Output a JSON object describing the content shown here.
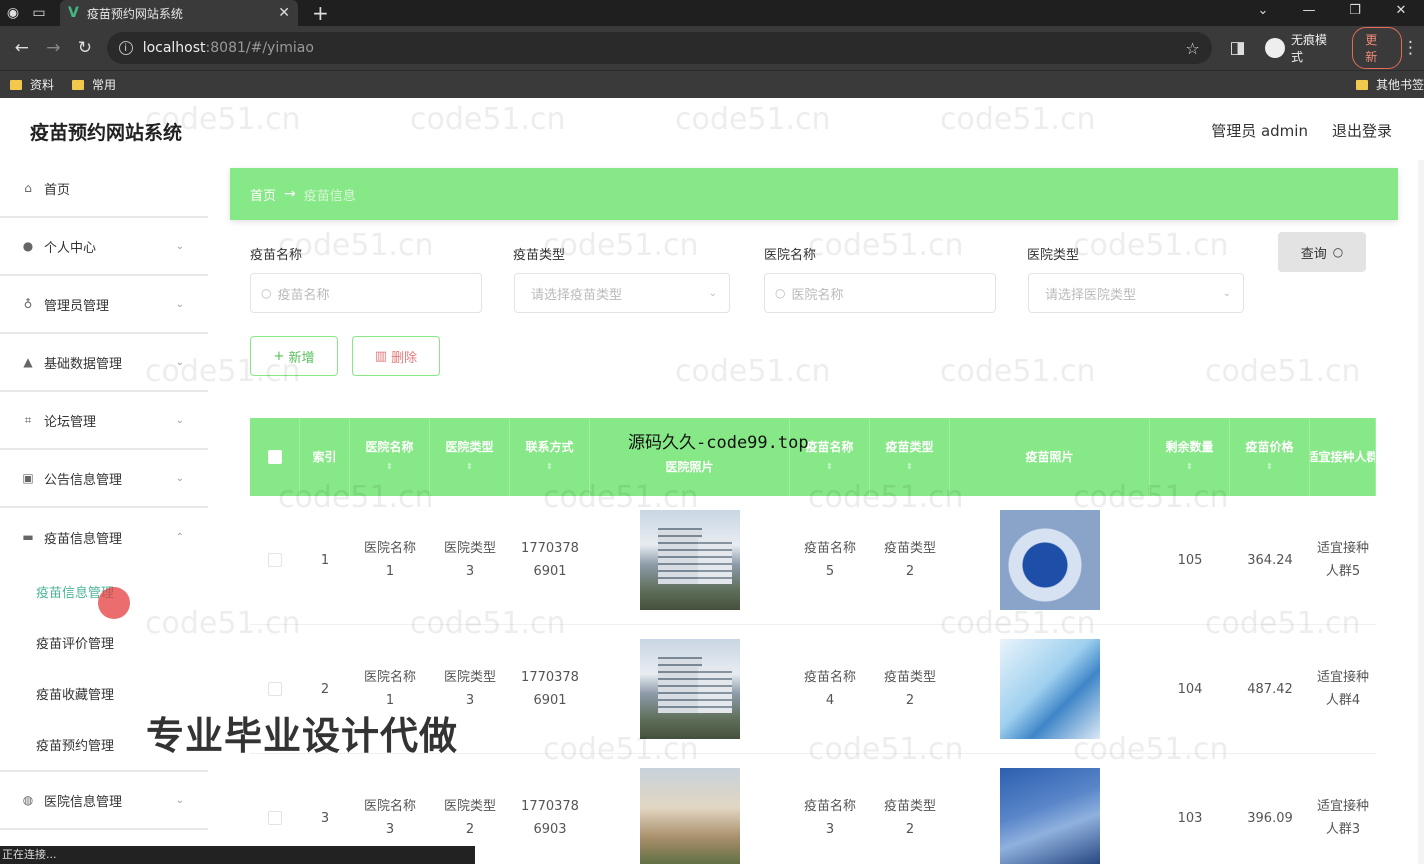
{
  "browser": {
    "tab_title": "疫苗预约网站系统",
    "tab_favicon": "V",
    "url_host": "localhost",
    "url_path": ":8081/#/yimiao",
    "incognito_label": "无痕模式",
    "update_label": "更新",
    "bookmarks": [
      "资料",
      "常用"
    ],
    "other_bookmarks": "其他书签"
  },
  "app": {
    "title": "疫苗预约网站系统",
    "admin_label": "管理员 admin",
    "logout_label": "退出登录"
  },
  "sidebar": {
    "items": [
      {
        "label": "首页",
        "icon": "home-icon"
      },
      {
        "label": "个人中心",
        "icon": "user-icon"
      },
      {
        "label": "管理员管理",
        "icon": "mic-icon"
      },
      {
        "label": "基础数据管理",
        "icon": "person-icon"
      },
      {
        "label": "论坛管理",
        "icon": "crop-icon"
      },
      {
        "label": "公告信息管理",
        "icon": "chart-icon"
      },
      {
        "label": "疫苗信息管理",
        "icon": "card-icon"
      },
      {
        "label": "医院信息管理",
        "icon": "globe-icon"
      }
    ],
    "submenu": [
      "疫苗信息管理",
      "疫苗评价管理",
      "疫苗收藏管理",
      "疫苗预约管理"
    ]
  },
  "breadcrumb": {
    "home": "首页",
    "current": "疫苗信息"
  },
  "filters": {
    "vaccine_name_label": "疫苗名称",
    "vaccine_name_placeholder": "疫苗名称",
    "vaccine_type_label": "疫苗类型",
    "vaccine_type_placeholder": "请选择疫苗类型",
    "hospital_name_label": "医院名称",
    "hospital_name_placeholder": "医院名称",
    "hospital_type_label": "医院类型",
    "hospital_type_placeholder": "请选择医院类型",
    "query_label": "查询"
  },
  "actions": {
    "add_label": "新增",
    "delete_label": "删除"
  },
  "table": {
    "headers": [
      "索引",
      "医院名称",
      "医院类型",
      "联系方式",
      "医院照片",
      "疫苗名称",
      "疫苗类型",
      "疫苗照片",
      "剩余数量",
      "疫苗价格",
      "适宜接种人群"
    ],
    "rows": [
      {
        "index": "1",
        "hospital_name": [
          "医院名称",
          "1"
        ],
        "hospital_type": [
          "医院类型",
          "3"
        ],
        "contact": [
          "1770378",
          "6901"
        ],
        "vaccine_name": [
          "疫苗名称",
          "5"
        ],
        "vaccine_type": [
          "疫苗类型",
          "2"
        ],
        "remaining": "105",
        "price": "364.24",
        "crowd": [
          "适宜接种",
          "人群5"
        ]
      },
      {
        "index": "2",
        "hospital_name": [
          "医院名称",
          "1"
        ],
        "hospital_type": [
          "医院类型",
          "3"
        ],
        "contact": [
          "1770378",
          "6901"
        ],
        "vaccine_name": [
          "疫苗名称",
          "4"
        ],
        "vaccine_type": [
          "疫苗类型",
          "2"
        ],
        "remaining": "104",
        "price": "487.42",
        "crowd": [
          "适宜接种",
          "人群4"
        ]
      },
      {
        "index": "3",
        "hospital_name": [
          "医院名称",
          "3"
        ],
        "hospital_type": [
          "医院类型",
          "2"
        ],
        "contact": [
          "1770378",
          "6903"
        ],
        "vaccine_name": [
          "疫苗名称",
          "3"
        ],
        "vaccine_type": [
          "疫苗类型",
          "2"
        ],
        "remaining": "103",
        "price": "396.09",
        "crowd": [
          "适宜接种",
          "人群3"
        ]
      }
    ]
  },
  "overlays": {
    "watermark": "code51.cn",
    "code_watermark": "源码久久-code99.top",
    "ad_text": "专业毕业设计代做"
  },
  "status_text": "正在连接...",
  "colors": {
    "accent_green": "#86e886",
    "active_menu": "#4db39a"
  }
}
